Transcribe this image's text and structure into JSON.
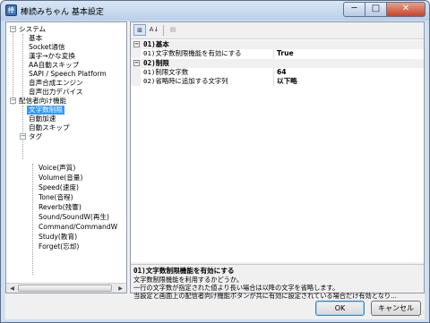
{
  "window": {
    "title": "棒読みちゃん 基本設定"
  },
  "caption": {
    "minimize": "─",
    "maximize": "□",
    "close": "✕"
  },
  "tree": {
    "items": [
      {
        "label": "システム"
      },
      {
        "label": "基本"
      },
      {
        "label": "Socket通信"
      },
      {
        "label": "漢字→かな変換"
      },
      {
        "label": "AA自動スキップ"
      },
      {
        "label": "SAPI / Speech Platform"
      },
      {
        "label": "音声合成エンジン"
      },
      {
        "label": "音声出力デバイス"
      },
      {
        "label": "配信者向け機能"
      },
      {
        "label": "文字数制限"
      },
      {
        "label": "自動加速"
      },
      {
        "label": "自動スキップ"
      },
      {
        "label": "タグ"
      },
      {
        "label": "Voice(声質)"
      },
      {
        "label": "Volume(音量)"
      },
      {
        "label": "Speed(速度)"
      },
      {
        "label": "Tone(音程)"
      },
      {
        "label": "Reverb(残響)"
      },
      {
        "label": "Sound/SoundW(再生)"
      },
      {
        "label": "Command/CommandW"
      },
      {
        "label": "Study(教育)"
      },
      {
        "label": "Forget(忘却)"
      }
    ],
    "selected": "文字数制限"
  },
  "toolbar": {
    "categorized": "⊞",
    "alphabetical": "A↓",
    "pages": "▤"
  },
  "properties": {
    "categories": [
      {
        "label": "01)基本",
        "rows": [
          {
            "name": "01)文字数制限機能を有効にする",
            "value": "True"
          }
        ]
      },
      {
        "label": "02)制限",
        "rows": [
          {
            "name": "01)制限文字数",
            "value": "64"
          },
          {
            "name": "02)省略時に追加する文字列",
            "value": "以下略"
          }
        ]
      }
    ]
  },
  "description": {
    "title": "01)文字数制限機能を有効にする",
    "lines": [
      "文字数制限機能を利用するかどうか。",
      "一行の文字数が指定された値より長い場合は以降の文字を省略します。",
      "当設定と画面上の配信者向け機能ボタンが共に有効に設定されている場合だけ有効となり..."
    ]
  },
  "buttons": {
    "ok": "OK",
    "cancel": "キャンセル"
  }
}
